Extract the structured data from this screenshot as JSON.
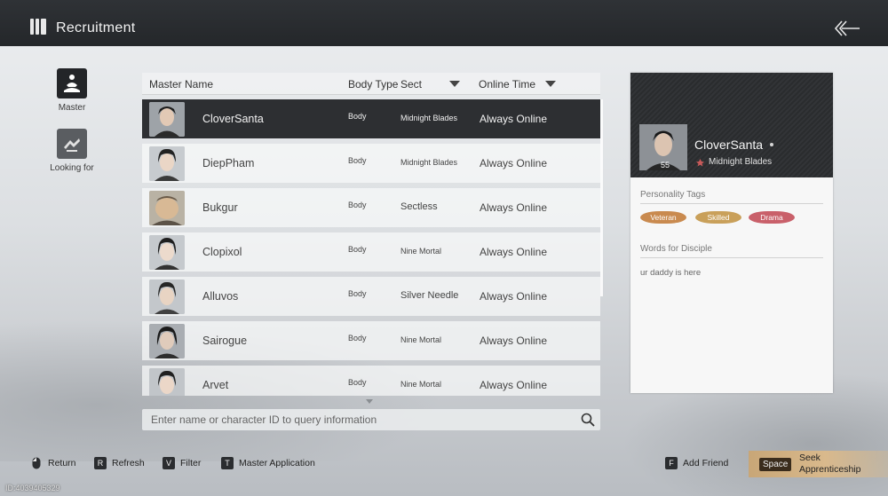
{
  "header": {
    "title": "Recruitment"
  },
  "side_tabs": [
    {
      "label": "Master",
      "icon": "master-icon",
      "active": true
    },
    {
      "label": "Looking for",
      "icon": "looking-for-icon",
      "active": false
    }
  ],
  "list": {
    "columns": {
      "master_name": "Master Name",
      "body_type": "Body Type",
      "sect": "Sect",
      "online_time": "Online Time"
    },
    "rows": [
      {
        "name": "CloverSanta",
        "body": "Body",
        "sect": "Midnight Blades",
        "online": "Always Online",
        "selected": true
      },
      {
        "name": "DiepPham",
        "body": "Body",
        "sect": "Midnight Blades",
        "online": "Always Online",
        "selected": false
      },
      {
        "name": "Bukgur",
        "body": "Body",
        "sect": "Sectless",
        "online": "Always Online",
        "selected": false
      },
      {
        "name": "Clopixol",
        "body": "Body",
        "sect": "Nine Mortal",
        "online": "Always Online",
        "selected": false
      },
      {
        "name": "Alluvos",
        "body": "Body",
        "sect": "Silver Needle",
        "online": "Always Online",
        "selected": false
      },
      {
        "name": "Sairogue",
        "body": "Body",
        "sect": "Nine Mortal",
        "online": "Always Online",
        "selected": false
      },
      {
        "name": "Arvet",
        "body": "Body",
        "sect": "Nine Mortal",
        "online": "Always Online",
        "selected": false
      }
    ]
  },
  "search": {
    "placeholder": "Enter name or character ID to query information"
  },
  "profile": {
    "name": "CloverSanta",
    "level": "55",
    "sect": "Midnight Blades",
    "personality_title": "Personality Tags",
    "tags": [
      {
        "label": "Veteran",
        "color": "#c98a4f"
      },
      {
        "label": "Skilled",
        "color": "#c9a05a"
      },
      {
        "label": "Drama",
        "color": "#c9606a"
      }
    ],
    "words_title": "Words for Disciple",
    "words": "ur daddy is here"
  },
  "footer": {
    "hints": [
      {
        "key": "mouse-icon",
        "label": "Return"
      },
      {
        "key": "R",
        "label": "Refresh"
      },
      {
        "key": "V",
        "label": "Filter"
      },
      {
        "key": "T",
        "label": "Master Application"
      }
    ],
    "add_friend": {
      "key": "F",
      "label": "Add Friend"
    },
    "seek": {
      "key": "Space",
      "label": "Seek Apprenticeship"
    },
    "uid": "ID:4039405329"
  }
}
